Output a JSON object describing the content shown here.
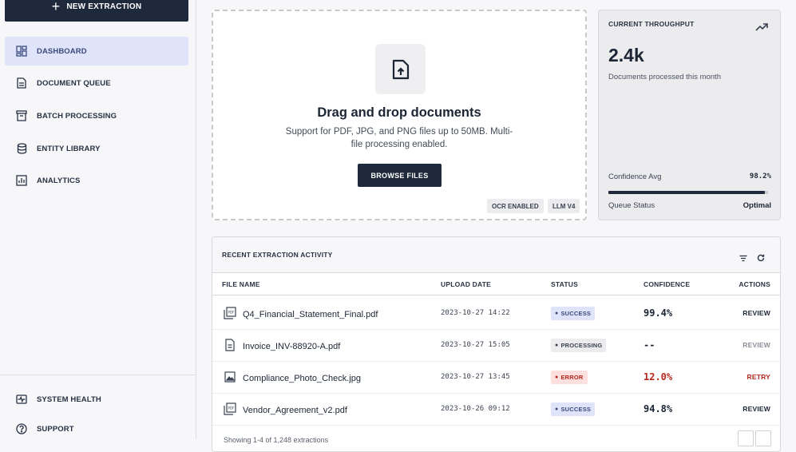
{
  "sidebar": {
    "new_button": "NEW EXTRACTION",
    "items": [
      {
        "label": "DASHBOARD",
        "icon": "dashboard-icon",
        "active": true
      },
      {
        "label": "DOCUMENT QUEUE",
        "icon": "document-icon",
        "active": false
      },
      {
        "label": "BATCH PROCESSING",
        "icon": "archive-icon",
        "active": false
      },
      {
        "label": "ENTITY LIBRARY",
        "icon": "database-icon",
        "active": false
      },
      {
        "label": "ANALYTICS",
        "icon": "analytics-icon",
        "active": false
      }
    ],
    "bottom_items": [
      {
        "label": "SYSTEM HEALTH",
        "icon": "health-icon"
      },
      {
        "label": "SUPPORT",
        "icon": "help-icon"
      }
    ]
  },
  "upload": {
    "title": "Drag and drop documents",
    "description": "Support for PDF, JPG, and PNG files up to 50MB. Multi-file processing enabled.",
    "button": "BROWSE FILES",
    "tags": [
      "OCR ENABLED",
      "LLM V4"
    ]
  },
  "throughput": {
    "label": "CURRENT THROUGHPUT",
    "value": "2.4k",
    "subtitle": "Documents processed this month",
    "confidence_label": "Confidence Avg",
    "confidence_value": "98.2%",
    "confidence_fraction": 0.982,
    "queue_label": "Queue Status",
    "queue_value": "Optimal"
  },
  "activity": {
    "title": "RECENT EXTRACTION ACTIVITY",
    "columns": [
      "FILE NAME",
      "UPLOAD DATE",
      "STATUS",
      "CONFIDENCE",
      "ACTIONS"
    ],
    "rows": [
      {
        "file": "Q4_Financial_Statement_Final.pdf",
        "icon": "pdf-icon",
        "date": "2023-10-27 14:22",
        "status": "SUCCESS",
        "confidence": "99.4%",
        "action": "REVIEW"
      },
      {
        "file": "Invoice_INV-88920-A.pdf",
        "icon": "document-icon",
        "date": "2023-10-27 15:05",
        "status": "PROCESSING",
        "confidence": "--",
        "action": "REVIEW"
      },
      {
        "file": "Compliance_Photo_Check.jpg",
        "icon": "image-icon",
        "date": "2023-10-27 13:45",
        "status": "ERROR",
        "confidence": "12.0%",
        "action": "RETRY"
      },
      {
        "file": "Vendor_Agreement_v2.pdf",
        "icon": "pdf-icon",
        "date": "2023-10-26 09:12",
        "status": "SUCCESS",
        "confidence": "94.8%",
        "action": "REVIEW"
      }
    ],
    "footer": "Showing 1-4 of 1,248 extractions"
  },
  "colors": {
    "primary": "#1e293b",
    "active_nav": "#dfe4fb",
    "error": "#b3261e"
  }
}
